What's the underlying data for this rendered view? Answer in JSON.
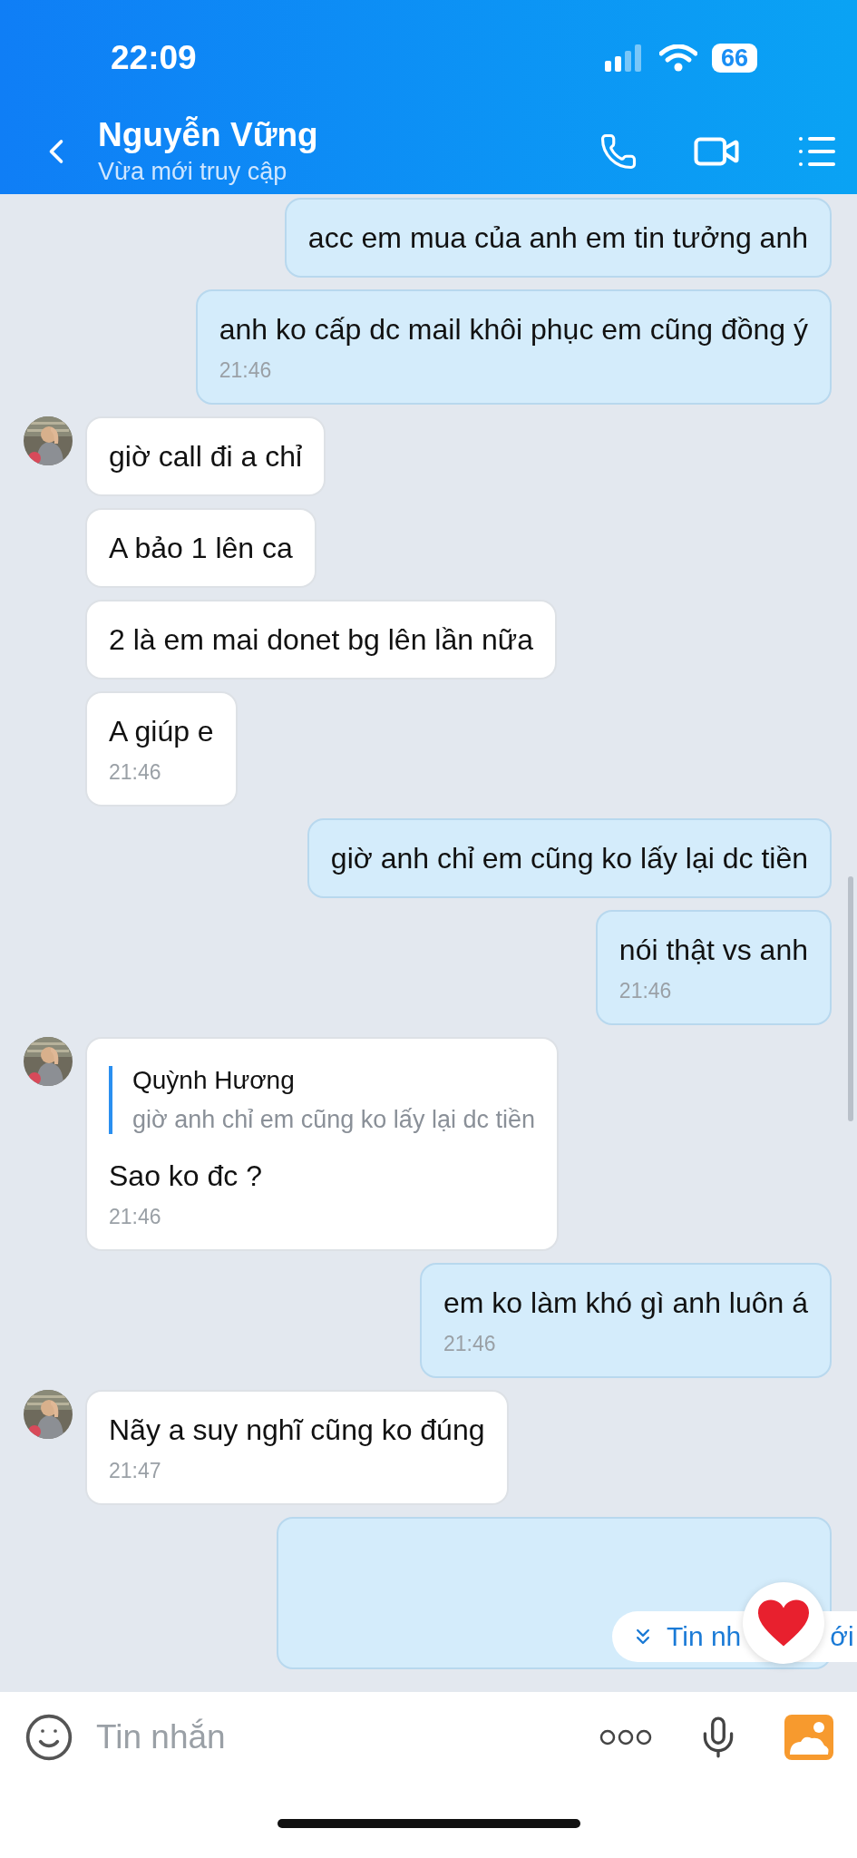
{
  "status_bar": {
    "time": "22:09",
    "battery": "66"
  },
  "header": {
    "title": "Nguyễn Vững",
    "subtitle": "Vừa mới truy cập"
  },
  "messages": [
    {
      "kind": "text",
      "outgoing": true,
      "text": "acc em mua của anh em tin tưởng anh"
    },
    {
      "kind": "text",
      "outgoing": true,
      "text": "anh ko cấp dc mail khôi phục em cũng đồng ý",
      "time": "21:46"
    },
    {
      "kind": "text",
      "outgoing": false,
      "avatar": true,
      "text": "giờ call đi a chỉ"
    },
    {
      "kind": "text",
      "outgoing": false,
      "avatar": false,
      "text": "A bảo 1 lên ca"
    },
    {
      "kind": "text",
      "outgoing": false,
      "avatar": false,
      "text": "2 là em mai donet bg lên lần nữa"
    },
    {
      "kind": "text",
      "outgoing": false,
      "avatar": false,
      "text": "A giúp e",
      "time": "21:46"
    },
    {
      "kind": "text",
      "outgoing": true,
      "text": "giờ anh chỉ em cũng ko lấy lại dc tiền"
    },
    {
      "kind": "text",
      "outgoing": true,
      "text": "nói thật vs anh",
      "time": "21:46"
    },
    {
      "kind": "reply",
      "outgoing": false,
      "avatar": true,
      "quote_author": "Quỳnh Hương",
      "quote_text": "giờ anh chỉ em cũng ko lấy lại dc tiền",
      "text": "Sao ko đc ?",
      "time": "21:46"
    },
    {
      "kind": "text",
      "outgoing": true,
      "text": "em ko làm khó gì anh luôn á",
      "time": "21:46"
    },
    {
      "kind": "text",
      "outgoing": false,
      "avatar": true,
      "text": "Nãy a suy nghĩ cũng ko đúng",
      "time": "21:47"
    },
    {
      "kind": "partial",
      "outgoing": true
    }
  ],
  "new_messages_pill": {
    "text_start": "Tin nh",
    "text_end": "ới"
  },
  "composer": {
    "placeholder": "Tin nhắn"
  }
}
